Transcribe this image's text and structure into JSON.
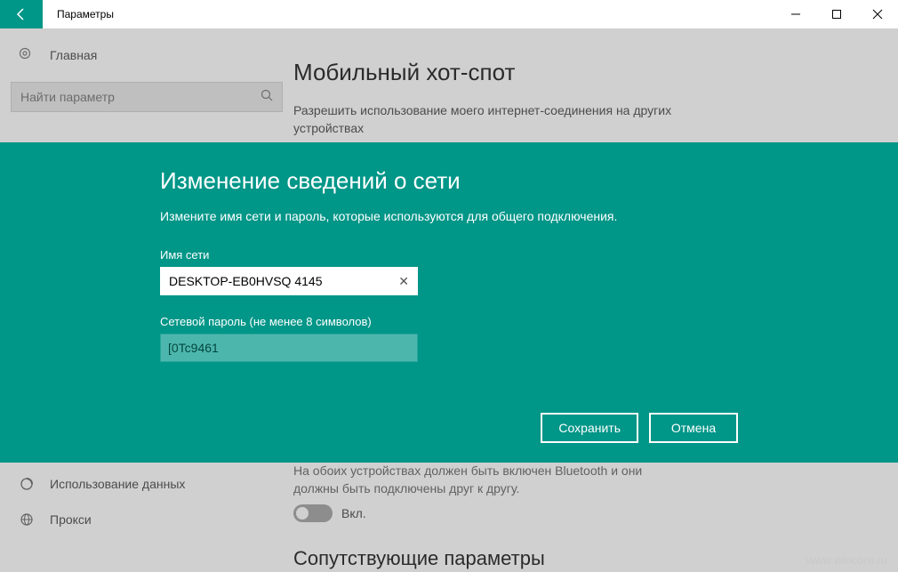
{
  "titlebar": {
    "title": "Параметры"
  },
  "sidebar": {
    "home": "Главная",
    "search_placeholder": "Найти параметр",
    "items": {
      "data_usage": "Использование данных",
      "proxy": "Прокси"
    }
  },
  "content": {
    "page_title": "Мобильный хот-спот",
    "share_text": "Разрешить использование моего интернет-соединения на других устройствах",
    "bluetooth_text": "На обоих устройствах должен быть включен Bluetooth и они должны быть подключены друг к другу.",
    "toggle_label": "Вкл.",
    "related_title": "Сопутствующие параметры"
  },
  "modal": {
    "title": "Изменение сведений о сети",
    "subtitle": "Измените имя сети и пароль, которые используются для общего подключения.",
    "network_name_label": "Имя сети",
    "network_name_value": "DESKTOP-EB0HVSQ 4145",
    "password_label": "Сетевой пароль (не менее 8 символов)",
    "password_value": "[0Tc9461",
    "save": "Сохранить",
    "cancel": "Отмена"
  },
  "watermark": "www.wincore.ru"
}
